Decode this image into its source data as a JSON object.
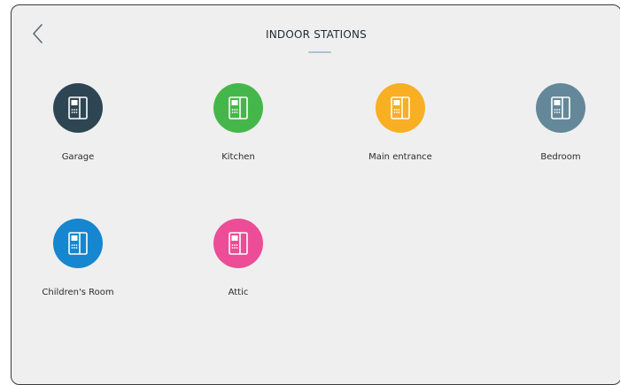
{
  "header": {
    "title": "INDOOR STATIONS"
  },
  "stations": [
    {
      "label": "Garage",
      "color": "#2e4653"
    },
    {
      "label": "Kitchen",
      "color": "#45b74a"
    },
    {
      "label": "Main entrance",
      "color": "#f9af23"
    },
    {
      "label": "Bedroom",
      "color": "#648899"
    },
    {
      "label": "Children's Room",
      "color": "#1586cf"
    },
    {
      "label": "Attic",
      "color": "#ec4d96"
    }
  ],
  "icons": {
    "back": "chevron-left-icon",
    "station": "intercom-station-icon"
  }
}
